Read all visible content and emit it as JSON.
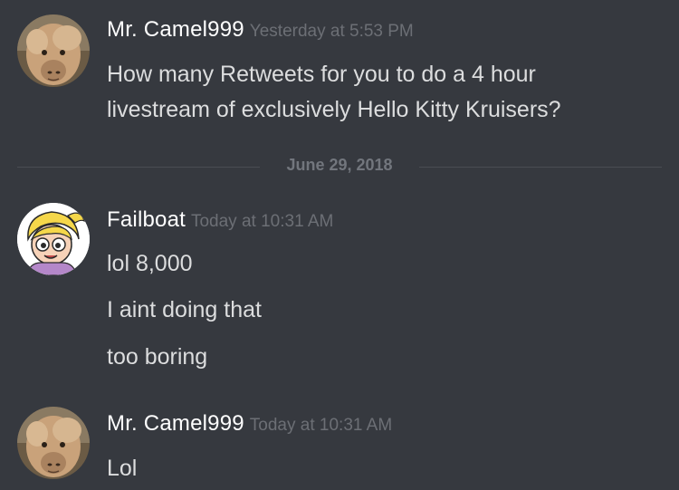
{
  "messages": [
    {
      "author": "Mr. Camel999",
      "timestamp": "Yesterday at 5:53 PM",
      "lines": [
        "How many Retweets for you to do a 4 hour",
        "livestream of exclusively Hello Kitty Kruisers?"
      ]
    },
    {
      "author": "Failboat",
      "timestamp": "Today at 10:31 AM",
      "lines": [
        "lol 8,000",
        "I aint doing that",
        "too boring"
      ]
    },
    {
      "author": "Mr. Camel999",
      "timestamp": "Today at 10:31 AM",
      "lines": [
        "Lol"
      ]
    }
  ],
  "date_divider": "June 29, 2018",
  "avatars": {
    "camel": "camel-avatar-icon",
    "failboat": "cartoon-girl-avatar-icon"
  },
  "colors": {
    "background": "#36393f",
    "username": "#ffffff",
    "timestamp": "#6c6f75",
    "message_text": "#dcddde",
    "divider": "#4a4d53"
  }
}
